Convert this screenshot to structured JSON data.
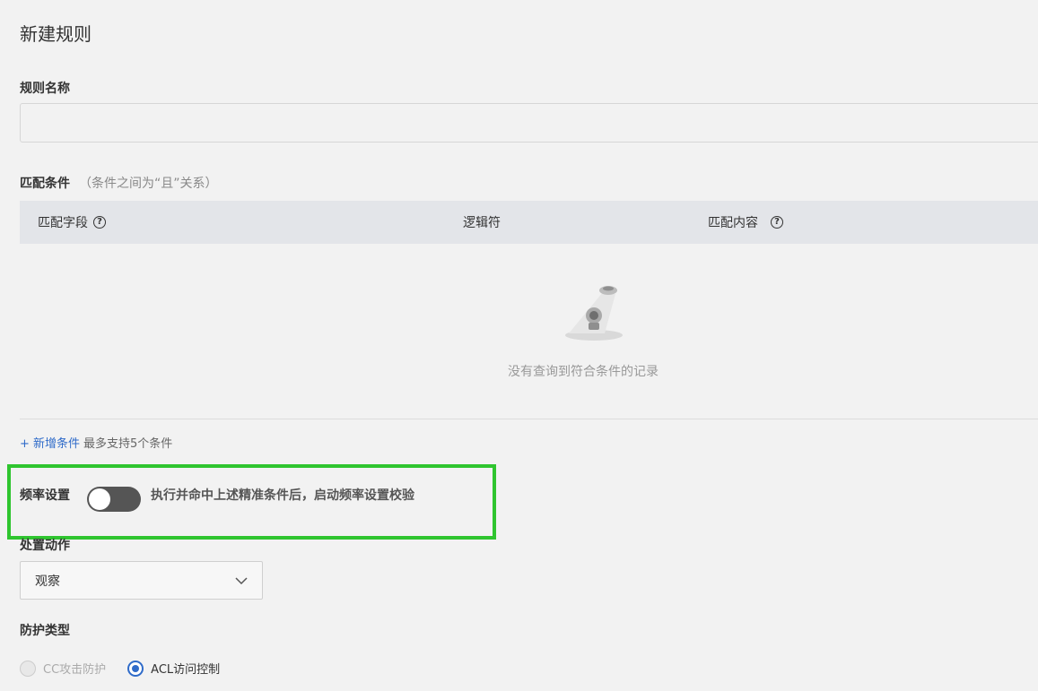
{
  "page_title": "新建规则",
  "rule_name": {
    "label": "规则名称",
    "value": ""
  },
  "match": {
    "label": "匹配条件",
    "note": "（条件之间为“且”关系）",
    "columns": [
      "匹配字段",
      "逻辑符",
      "匹配内容"
    ],
    "empty_text": "没有查询到符合条件的记录",
    "add_link": "+ 新增条件",
    "add_hint": "最多支持5个条件"
  },
  "frequency": {
    "label": "频率设置",
    "enabled": false,
    "description": "执行并命中上述精准条件后，启动频率设置校验"
  },
  "action": {
    "label": "处置动作",
    "selected": "观察"
  },
  "protection": {
    "label": "防护类型",
    "options": [
      "CC攻击防护",
      "ACL访问控制"
    ],
    "selected": "ACL访问控制"
  },
  "colors": {
    "accent": "#2f6bc9",
    "highlight": "#2fc52f",
    "toggle_off": "#555555"
  },
  "icons": [
    "help-circle-icon",
    "empty-state-icon",
    "chevron-down-icon"
  ]
}
